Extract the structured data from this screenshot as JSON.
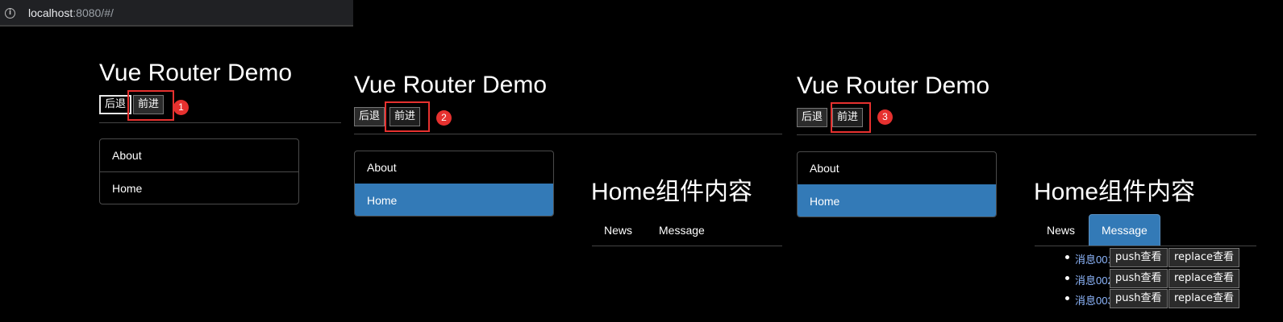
{
  "address_bar": {
    "host": "localhost",
    "rest": ":8080/#/"
  },
  "panels": [
    {
      "title": "Vue Router Demo",
      "back_label": "后退",
      "forward_label": "前进",
      "step": "1",
      "nav": [
        {
          "label": "About",
          "active": false
        },
        {
          "label": "Home",
          "active": false
        }
      ]
    },
    {
      "title": "Vue Router Demo",
      "back_label": "后退",
      "forward_label": "前进",
      "step": "2",
      "nav": [
        {
          "label": "About",
          "active": false
        },
        {
          "label": "Home",
          "active": true
        }
      ],
      "content_title": "Home组件内容",
      "tabs": [
        {
          "label": "News",
          "active": false
        },
        {
          "label": "Message",
          "active": false
        }
      ]
    },
    {
      "title": "Vue Router Demo",
      "back_label": "后退",
      "forward_label": "前进",
      "step": "3",
      "nav": [
        {
          "label": "About",
          "active": false
        },
        {
          "label": "Home",
          "active": true
        }
      ],
      "content_title": "Home组件内容",
      "tabs": [
        {
          "label": "News",
          "active": false
        },
        {
          "label": "Message",
          "active": true
        }
      ],
      "messages": [
        {
          "title": "消息001",
          "push_label": "push查看",
          "replace_label": "replace查看"
        },
        {
          "title": "消息002",
          "push_label": "push查看",
          "replace_label": "replace查看"
        },
        {
          "title": "消息003",
          "push_label": "push查看",
          "replace_label": "replace查看"
        }
      ]
    }
  ],
  "colors": {
    "active": "#337ab7",
    "highlight": "#e6312f",
    "link": "#8fb8ff"
  }
}
